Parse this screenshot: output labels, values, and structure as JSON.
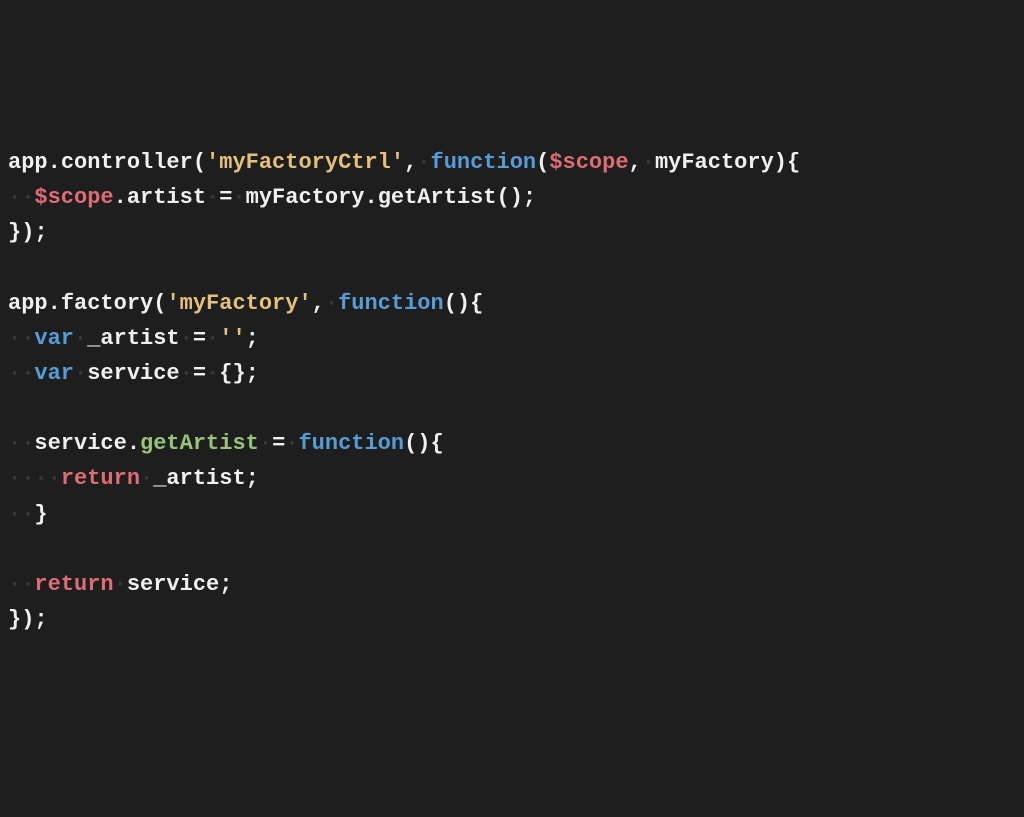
{
  "code": {
    "tokens": [
      [
        {
          "t": "app",
          "c": "default"
        },
        {
          "t": ".",
          "c": "dot"
        },
        {
          "t": "controller",
          "c": "default"
        },
        {
          "t": "(",
          "c": "paren"
        },
        {
          "t": "'myFactoryCtrl'",
          "c": "string"
        },
        {
          "t": ",",
          "c": "comma"
        },
        {
          "t": "·",
          "c": "whitespace"
        },
        {
          "t": "function",
          "c": "keyword-blue"
        },
        {
          "t": "(",
          "c": "paren"
        },
        {
          "t": "$scope",
          "c": "dollar"
        },
        {
          "t": ",",
          "c": "comma"
        },
        {
          "t": "·",
          "c": "whitespace"
        },
        {
          "t": "myFactory",
          "c": "default"
        },
        {
          "t": ")",
          "c": "paren"
        },
        {
          "t": "{",
          "c": "brace"
        }
      ],
      [
        {
          "t": "··",
          "c": "whitespace"
        },
        {
          "t": "$scope",
          "c": "dollar"
        },
        {
          "t": ".",
          "c": "dot"
        },
        {
          "t": "artist",
          "c": "default"
        },
        {
          "t": "·",
          "c": "whitespace"
        },
        {
          "t": "=",
          "c": "equals"
        },
        {
          "t": "·",
          "c": "whitespace"
        },
        {
          "t": "myFactory",
          "c": "default"
        },
        {
          "t": ".",
          "c": "dot"
        },
        {
          "t": "getArtist",
          "c": "default"
        },
        {
          "t": "(",
          "c": "paren"
        },
        {
          "t": ")",
          "c": "paren"
        },
        {
          "t": ";",
          "c": "semicolon"
        }
      ],
      [
        {
          "t": "}",
          "c": "brace"
        },
        {
          "t": ")",
          "c": "paren"
        },
        {
          "t": ";",
          "c": "semicolon"
        }
      ],
      [],
      [
        {
          "t": "app",
          "c": "default"
        },
        {
          "t": ".",
          "c": "dot"
        },
        {
          "t": "factory",
          "c": "default"
        },
        {
          "t": "(",
          "c": "paren"
        },
        {
          "t": "'myFactory'",
          "c": "string"
        },
        {
          "t": ",",
          "c": "comma"
        },
        {
          "t": "·",
          "c": "whitespace"
        },
        {
          "t": "function",
          "c": "keyword-blue"
        },
        {
          "t": "(",
          "c": "paren"
        },
        {
          "t": ")",
          "c": "paren"
        },
        {
          "t": "{",
          "c": "brace"
        }
      ],
      [
        {
          "t": "··",
          "c": "whitespace"
        },
        {
          "t": "var",
          "c": "keyword-blue"
        },
        {
          "t": "·",
          "c": "whitespace"
        },
        {
          "t": "_artist",
          "c": "default"
        },
        {
          "t": "·",
          "c": "whitespace"
        },
        {
          "t": "=",
          "c": "equals"
        },
        {
          "t": "·",
          "c": "whitespace"
        },
        {
          "t": "''",
          "c": "string"
        },
        {
          "t": ";",
          "c": "semicolon"
        }
      ],
      [
        {
          "t": "··",
          "c": "whitespace"
        },
        {
          "t": "var",
          "c": "keyword-blue"
        },
        {
          "t": "·",
          "c": "whitespace"
        },
        {
          "t": "service",
          "c": "default"
        },
        {
          "t": "·",
          "c": "whitespace"
        },
        {
          "t": "=",
          "c": "equals"
        },
        {
          "t": "·",
          "c": "whitespace"
        },
        {
          "t": "{",
          "c": "brace"
        },
        {
          "t": "}",
          "c": "brace"
        },
        {
          "t": ";",
          "c": "semicolon"
        }
      ],
      [],
      [
        {
          "t": "··",
          "c": "whitespace"
        },
        {
          "t": "service",
          "c": "default"
        },
        {
          "t": ".",
          "c": "dot"
        },
        {
          "t": "getArtist",
          "c": "function-name"
        },
        {
          "t": "·",
          "c": "whitespace"
        },
        {
          "t": "=",
          "c": "equals"
        },
        {
          "t": "·",
          "c": "whitespace"
        },
        {
          "t": "function",
          "c": "keyword-blue"
        },
        {
          "t": "(",
          "c": "paren"
        },
        {
          "t": ")",
          "c": "paren"
        },
        {
          "t": "{",
          "c": "brace"
        }
      ],
      [
        {
          "t": "····",
          "c": "whitespace"
        },
        {
          "t": "return",
          "c": "keyword-red"
        },
        {
          "t": "·",
          "c": "whitespace"
        },
        {
          "t": "_artist",
          "c": "default"
        },
        {
          "t": ";",
          "c": "semicolon"
        }
      ],
      [
        {
          "t": "··",
          "c": "whitespace"
        },
        {
          "t": "}",
          "c": "brace"
        }
      ],
      [],
      [
        {
          "t": "··",
          "c": "whitespace"
        },
        {
          "t": "return",
          "c": "keyword-red"
        },
        {
          "t": "·",
          "c": "whitespace"
        },
        {
          "t": "service",
          "c": "default"
        },
        {
          "t": ";",
          "c": "semicolon"
        }
      ],
      [
        {
          "t": "}",
          "c": "brace"
        },
        {
          "t": ")",
          "c": "paren"
        },
        {
          "t": ";",
          "c": "semicolon"
        }
      ]
    ]
  }
}
